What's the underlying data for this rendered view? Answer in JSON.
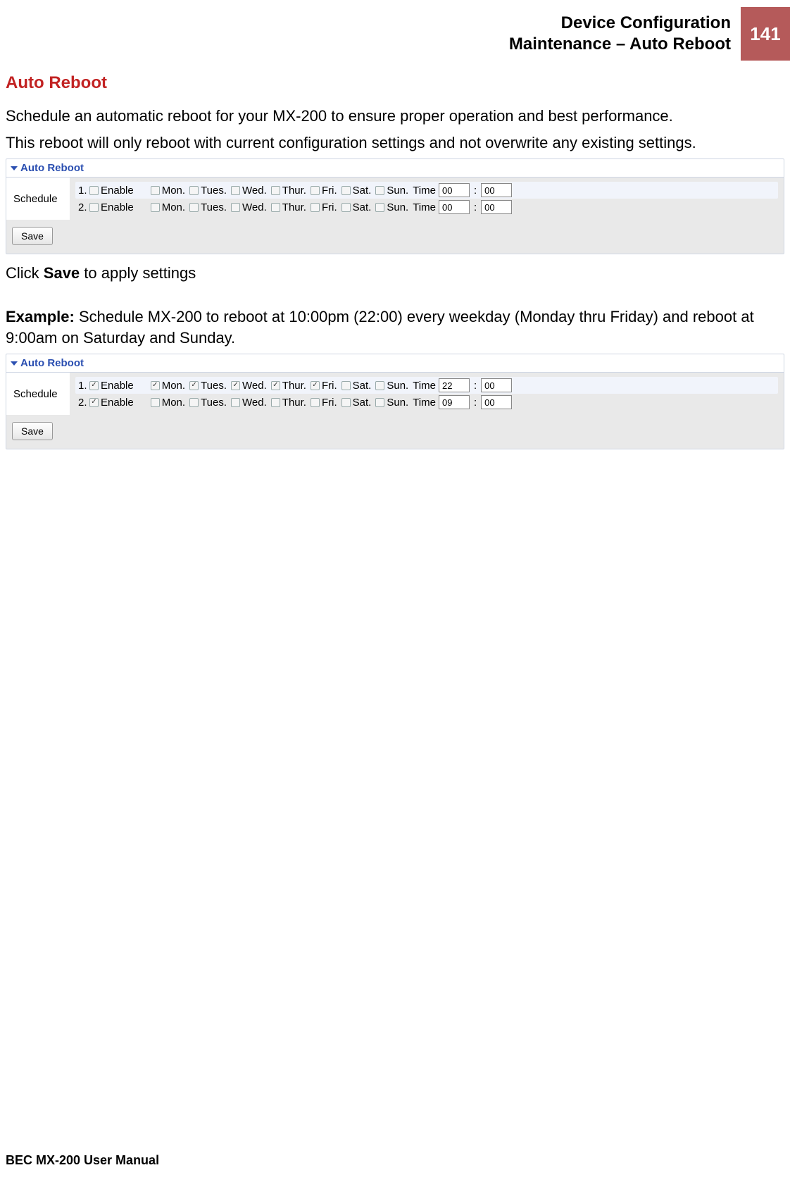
{
  "header": {
    "line1": "Device Configuration",
    "line2": "Maintenance – Auto Reboot",
    "page_number": "141"
  },
  "section_title": "Auto Reboot",
  "intro1": "Schedule an automatic reboot for your MX-200 to ensure proper operation and best performance.",
  "intro2": "This reboot will only reboot with current configuration settings and not overwrite any existing settings.",
  "panel_title": "Auto Reboot",
  "schedule_label": "Schedule",
  "enable_label": "Enable",
  "days": {
    "mon": "Mon.",
    "tue": "Tues.",
    "wed": "Wed.",
    "thu": "Thur.",
    "fri": "Fri.",
    "sat": "Sat.",
    "sun": "Sun."
  },
  "time_label": "Time",
  "save_label": "Save",
  "panels": {
    "first": {
      "rows": [
        {
          "index": "1.",
          "enable": false,
          "mon": false,
          "tue": false,
          "wed": false,
          "thu": false,
          "fri": false,
          "sat": false,
          "sun": false,
          "hh": "00",
          "mm": "00"
        },
        {
          "index": "2.",
          "enable": false,
          "mon": false,
          "tue": false,
          "wed": false,
          "thu": false,
          "fri": false,
          "sat": false,
          "sun": false,
          "hh": "00",
          "mm": "00"
        }
      ]
    },
    "second": {
      "rows": [
        {
          "index": "1.",
          "enable": true,
          "mon": true,
          "tue": true,
          "wed": true,
          "thu": true,
          "fri": true,
          "sat": false,
          "sun": false,
          "hh": "22",
          "mm": "00"
        },
        {
          "index": "2.",
          "enable": true,
          "mon": false,
          "tue": false,
          "wed": false,
          "thu": false,
          "fri": false,
          "sat": false,
          "sun": false,
          "hh": "09",
          "mm": "00"
        }
      ]
    }
  },
  "click_save_prefix": "Click ",
  "click_save_bold": "Save",
  "click_save_suffix": " to apply settings",
  "example_bold": "Example:",
  "example_text": " Schedule MX-200 to reboot at 10:00pm (22:00) every weekday (Monday thru Friday) and reboot at 9:00am on Saturday and Sunday.",
  "footer": "BEC MX-200 User Manual"
}
